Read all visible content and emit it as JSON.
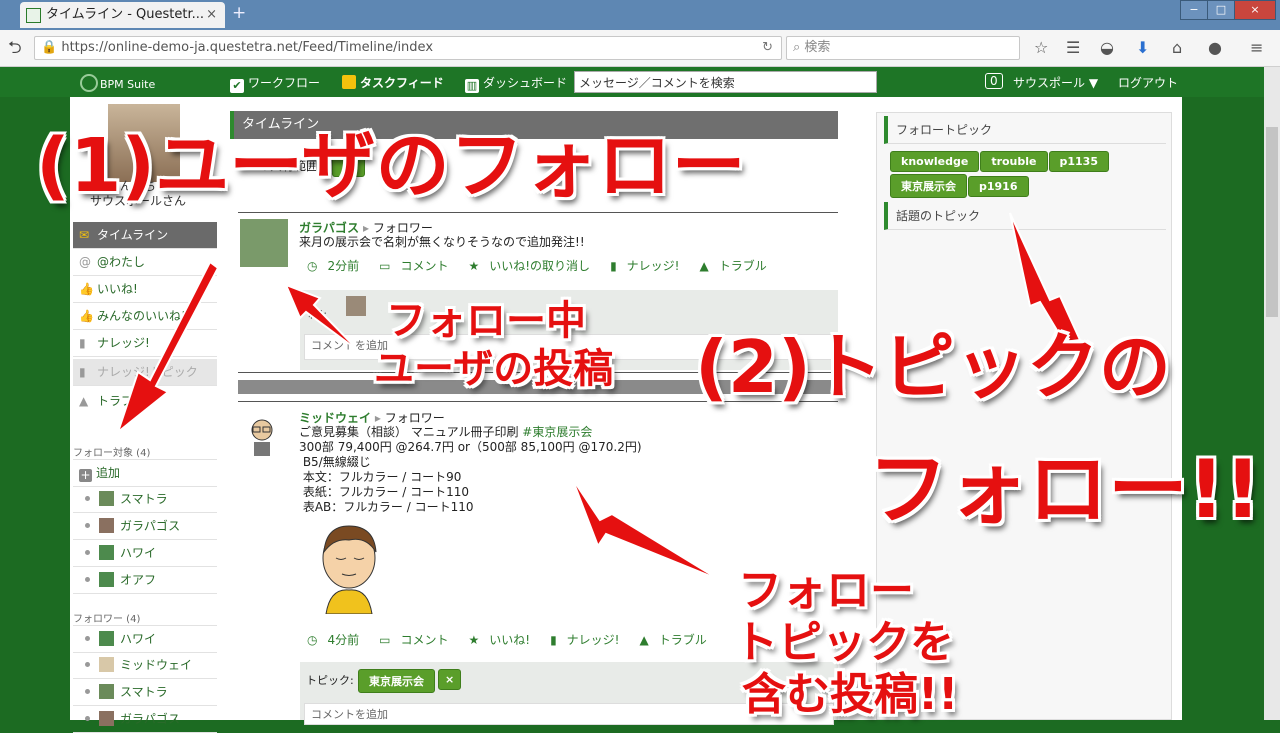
{
  "browser": {
    "tab_title": "タイムライン - Questetr...",
    "tab_close": "×",
    "new_tab": "+",
    "url": "https://online-demo-ja.questetra.net/Feed/Timeline/index",
    "search_placeholder": "検索",
    "win_buttons": [
      "−",
      "□",
      "×"
    ]
  },
  "header": {
    "logo": "BPM Suite",
    "nav": [
      "ワークフロー",
      "タスクフィード",
      "ダッシュボード"
    ],
    "search_value": "メッセージ／コメントを検索",
    "badge": "0",
    "user": "サウスポール ▼",
    "logout": "ログアウト"
  },
  "left": {
    "greeting_line1": "んにち",
    "greeting_line2": "サウスポールさん",
    "nav": [
      {
        "label": "タイムライン",
        "icon": "chat-icon",
        "glyph": "✉"
      },
      {
        "label": "@わたし",
        "icon": "at-icon",
        "glyph": "@"
      },
      {
        "label": "いいね!",
        "icon": "thumb-icon",
        "glyph": "👍"
      },
      {
        "label": "みんなのいいね!",
        "icon": "thumbs-icon",
        "glyph": "👍"
      },
      {
        "label": "ナレッジ!",
        "icon": "book-icon",
        "glyph": "▮"
      },
      {
        "label": "ナレッジ!トピック",
        "icon": "pin-icon",
        "glyph": "▮"
      },
      {
        "label": "トラブル",
        "icon": "warning-icon",
        "glyph": "▲"
      }
    ],
    "follow_title": "フォロー対象 (4)",
    "add_label": "追加",
    "follows": [
      "スマトラ",
      "ガラパゴス",
      "ハワイ",
      "オアフ"
    ],
    "followers_title": "フォロワー (4)",
    "followers": [
      "ハワイ",
      "ミッドウェイ",
      "スマトラ",
      "ガラパゴス"
    ]
  },
  "center": {
    "title": "タイムライン",
    "share_label": "の共有範囲:",
    "share_button": "フ",
    "post1": {
      "author": "ガラパゴス",
      "relation": "フォロワー",
      "text": "来月の展示会で名刺が無くなりそうなので追加発注!!",
      "time": "2分前",
      "comment": "コメント",
      "like": "いいね!の取り消し",
      "knowledge": "ナレッジ!",
      "trouble": "トラブル",
      "liked_label": "ね!:",
      "comment_placeholder": "コメントを追加"
    },
    "post2": {
      "author": "ミッドウェイ",
      "relation": "フォロワー",
      "line1": "ご意見募集（相談） マニュアル冊子印刷 ",
      "hashtag": "#東京展示会",
      "body": "300部 79,400円 @264.7円 or（500部 85,100円 @170.2円)\n B5/無線綴じ\n 本文：フルカラー / コート90\n 表紙：フルカラー / コート110\n 表AB：フルカラー / コート110",
      "time": "4分前",
      "comment": "コメント",
      "like": "いいね!",
      "knowledge": "ナレッジ!",
      "trouble": "トラブル",
      "topic_label": "トピック:",
      "topic_tag": "東京展示会",
      "topic_remove": "×",
      "comment_placeholder": "コメントを追加"
    }
  },
  "right": {
    "follow_topics_title": "フォロートピック",
    "follow_topics": [
      "knowledge",
      "trouble",
      "p1135",
      "東京展示会",
      "p1916"
    ],
    "hot_topics_title": "話題のトピック"
  },
  "overlay": {
    "label1": "(1)ユーザのフォロー",
    "label2_line1": "(2)トピックの",
    "label2_line2": "フォロー!!",
    "label3_line1": "フォロー中",
    "label3_line2": "ユーザの投稿",
    "label4_line1": "フォロー",
    "label4_line2": "トピックを",
    "label4_line3": "含む投稿!!",
    "color": "#e51010"
  }
}
